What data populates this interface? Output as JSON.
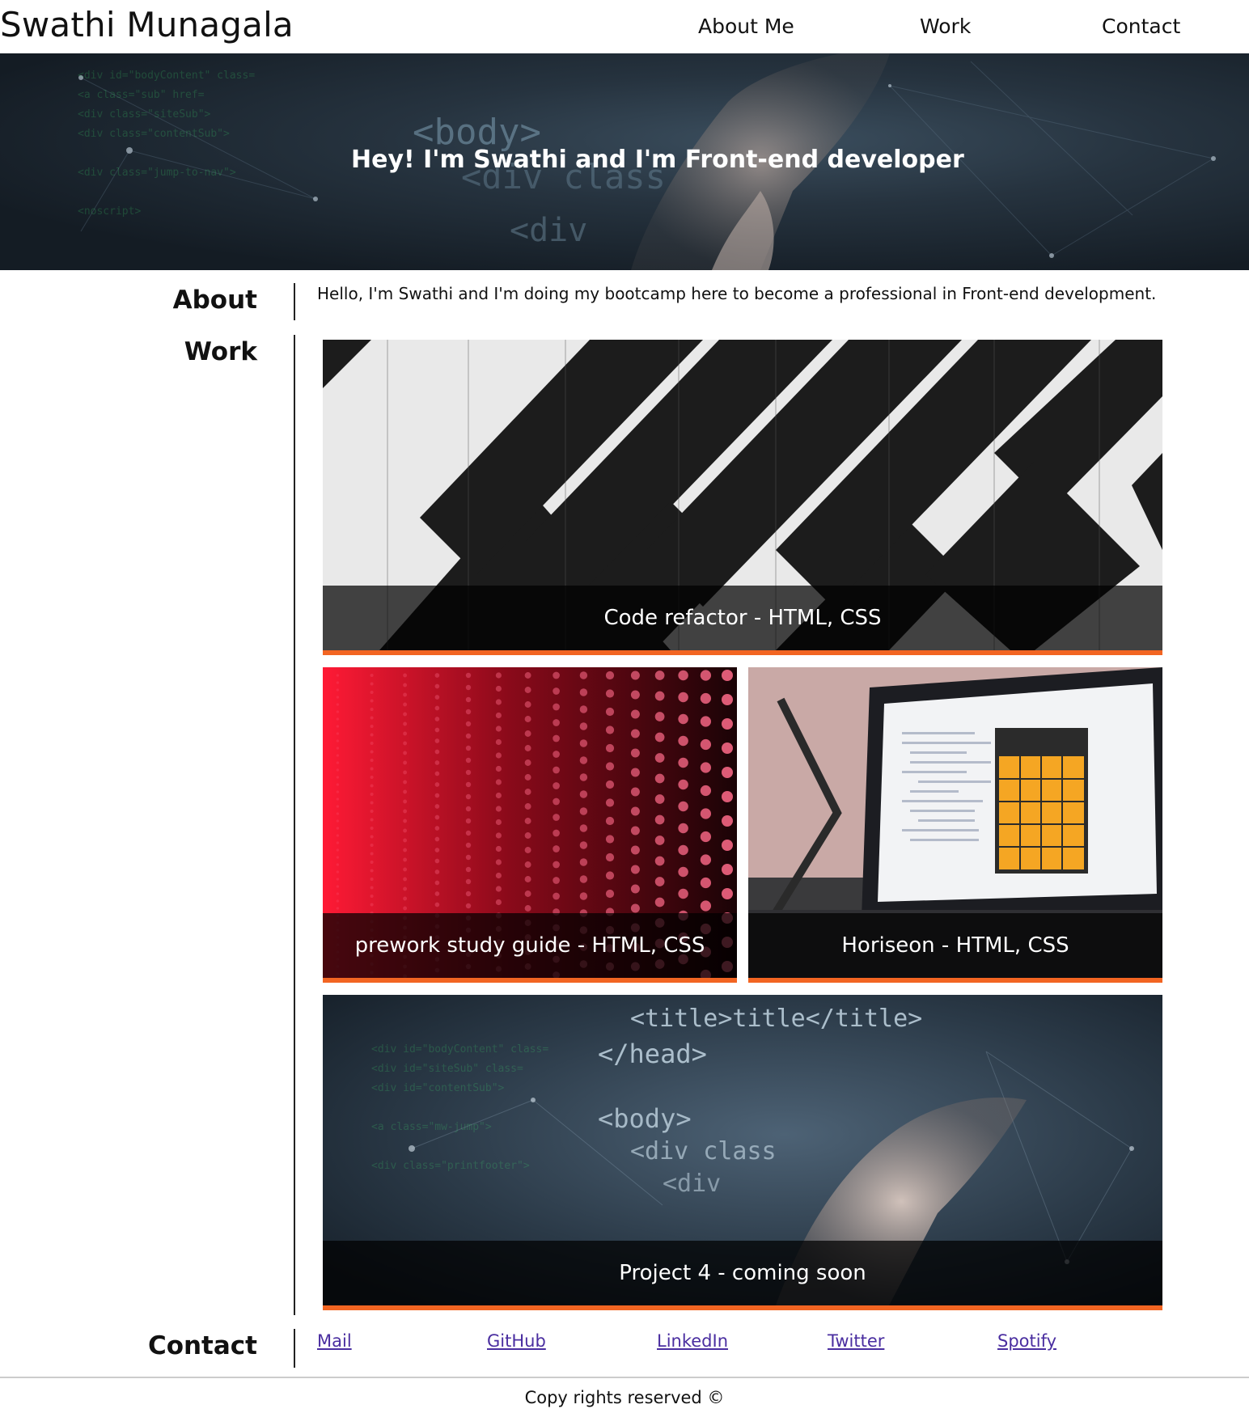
{
  "header": {
    "brand": "Swathi Munagala",
    "nav": [
      {
        "label": "About Me"
      },
      {
        "label": "Work"
      },
      {
        "label": "Contact"
      }
    ]
  },
  "hero": {
    "title": "Hey! I'm Swathi and I'm Front-end developer"
  },
  "about": {
    "heading": "About",
    "text": "Hello, I'm Swathi and I'm doing my bootcamp here to become a professional in Front-end development."
  },
  "work": {
    "heading": "Work",
    "projects": [
      {
        "caption": "Code refactor - HTML, CSS"
      },
      {
        "caption": "prework study guide - HTML, CSS"
      },
      {
        "caption": "Horiseon - HTML, CSS"
      },
      {
        "caption": "Project 4 - coming soon"
      }
    ]
  },
  "contact": {
    "heading": "Contact",
    "links": [
      {
        "label": "Mail"
      },
      {
        "label": "GitHub"
      },
      {
        "label": "LinkedIn"
      },
      {
        "label": "Twitter"
      },
      {
        "label": "Spotify"
      }
    ]
  },
  "footer": {
    "text": "Copy rights reserved ©"
  },
  "colors": {
    "accent": "#f26522",
    "link": "#4a2ea0",
    "caption_bg": "#000000"
  }
}
